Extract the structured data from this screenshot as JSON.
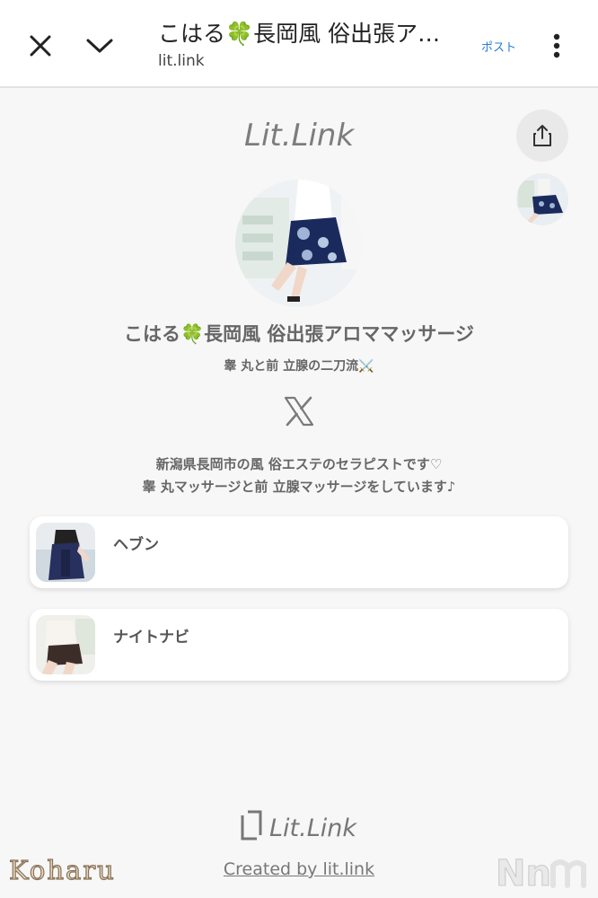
{
  "topbar": {
    "title": "こはる🍀長岡風 俗出張ア…",
    "url": "lit.link",
    "post_label": "ポスト",
    "close_icon": "close-icon",
    "chevron_icon": "chevron-down-icon",
    "menu_icon": "more-vertical-icon"
  },
  "profile": {
    "logo_text": "Lit.Link",
    "name": "こはる🍀長岡風 俗出張アロママッサージ",
    "subtitle": "睾 丸と前 立腺の二刀流⚔️",
    "social_icon": "x-logo-icon",
    "bio": [
      "新潟県長岡市の風 俗エステのセラピストです♡",
      "睾 丸マッサージと前 立腺マッサージをしています♪"
    ]
  },
  "links": [
    {
      "label": "ヘブン"
    },
    {
      "label": "ナイトナビ"
    }
  ],
  "footer": {
    "logo_text": "Lit.Link",
    "created_by": "Created by lit.link"
  },
  "watermark": {
    "left": "Koharu",
    "right": "Nn"
  },
  "colors": {
    "accent_link": "#2a7bd4",
    "background": "#f7f7f7"
  }
}
